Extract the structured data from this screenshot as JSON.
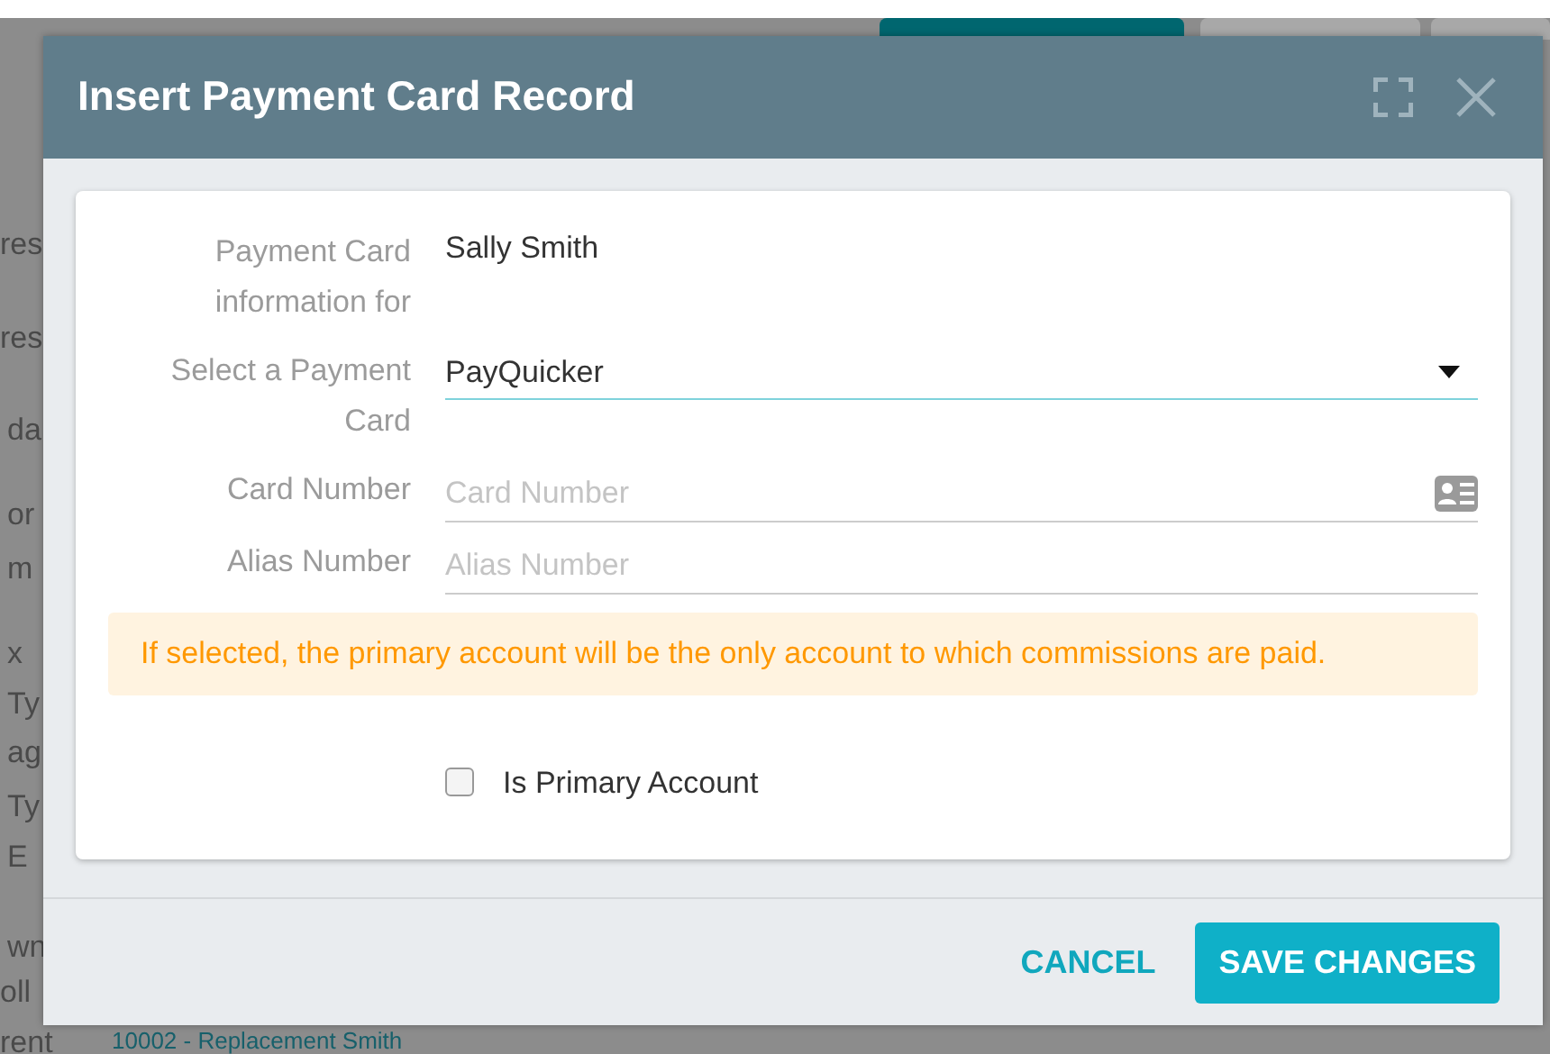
{
  "background": {
    "left_fragments": [
      "res",
      "res",
      "da",
      "or",
      "m",
      "x",
      "Ty",
      "ag",
      "Ty",
      "E",
      "wn",
      "oll",
      "rent"
    ],
    "bottom_link": "10002 - Replacement Smith"
  },
  "dialog": {
    "title": "Insert Payment Card Record",
    "fields": [
      {
        "kind": "static",
        "label": "Payment Card information for",
        "value": "Sally Smith"
      },
      {
        "kind": "select",
        "label": "Select a Payment Card",
        "value": "PayQuicker"
      },
      {
        "kind": "input",
        "label": "Card Number",
        "placeholder": "Card Number",
        "icon": true
      },
      {
        "kind": "input",
        "label": "Alias Number",
        "placeholder": "Alias Number",
        "icon": false
      }
    ],
    "notice": "If selected, the primary account will be the only account to which commissions are paid.",
    "checkbox": {
      "label": "Is Primary Account",
      "checked": false
    },
    "buttons": [
      {
        "label": "CANCEL",
        "kind": "link"
      },
      {
        "label": "SAVE CHANGES",
        "kind": "primary"
      }
    ]
  }
}
